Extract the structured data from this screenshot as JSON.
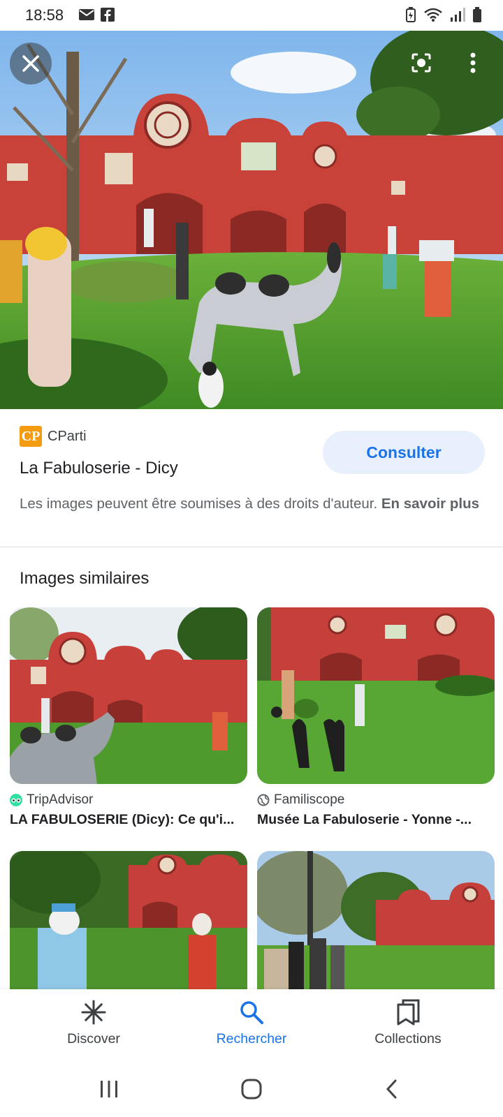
{
  "status_bar": {
    "time": "18:58",
    "left_icons": [
      "mail-icon",
      "facebook-icon"
    ],
    "right_icons": [
      "battery-saver-icon",
      "wifi-icon",
      "signal-icon",
      "battery-icon"
    ]
  },
  "viewer": {
    "close_icon": "close-icon",
    "lens_icon": "lens-icon",
    "more_icon": "more-vert-icon"
  },
  "source": {
    "logo_text": "CP",
    "name": "CParti",
    "title": "La Fabuloserie - Dicy",
    "button_label": "Consulter"
  },
  "copyright": {
    "text": "Les images peuvent être soumises à des droits d'auteur.",
    "link": "En savoir plus"
  },
  "similar": {
    "heading": "Images similaires",
    "items": [
      {
        "source": "TripAdvisor",
        "title": "LA FABULOSERIE (Dicy): Ce qu'i...",
        "source_icon": "tripadvisor-icon"
      },
      {
        "source": "Familiscope",
        "title": "Musée La Fabuloserie - Yonne -...",
        "source_icon": "globe-icon"
      },
      {
        "source": "",
        "title": "",
        "source_icon": ""
      },
      {
        "source": "",
        "title": "",
        "source_icon": ""
      }
    ]
  },
  "bottom_nav": {
    "items": [
      {
        "label": "Discover",
        "icon": "asterisk-icon",
        "active": false
      },
      {
        "label": "Rechercher",
        "icon": "search-icon",
        "active": true
      },
      {
        "label": "Collections",
        "icon": "collections-icon",
        "active": false
      }
    ]
  },
  "colors": {
    "accent": "#1a73e8",
    "button_bg": "#e8f0fe",
    "wall_red": "#c8423a",
    "grass": "#4f9a2c"
  }
}
